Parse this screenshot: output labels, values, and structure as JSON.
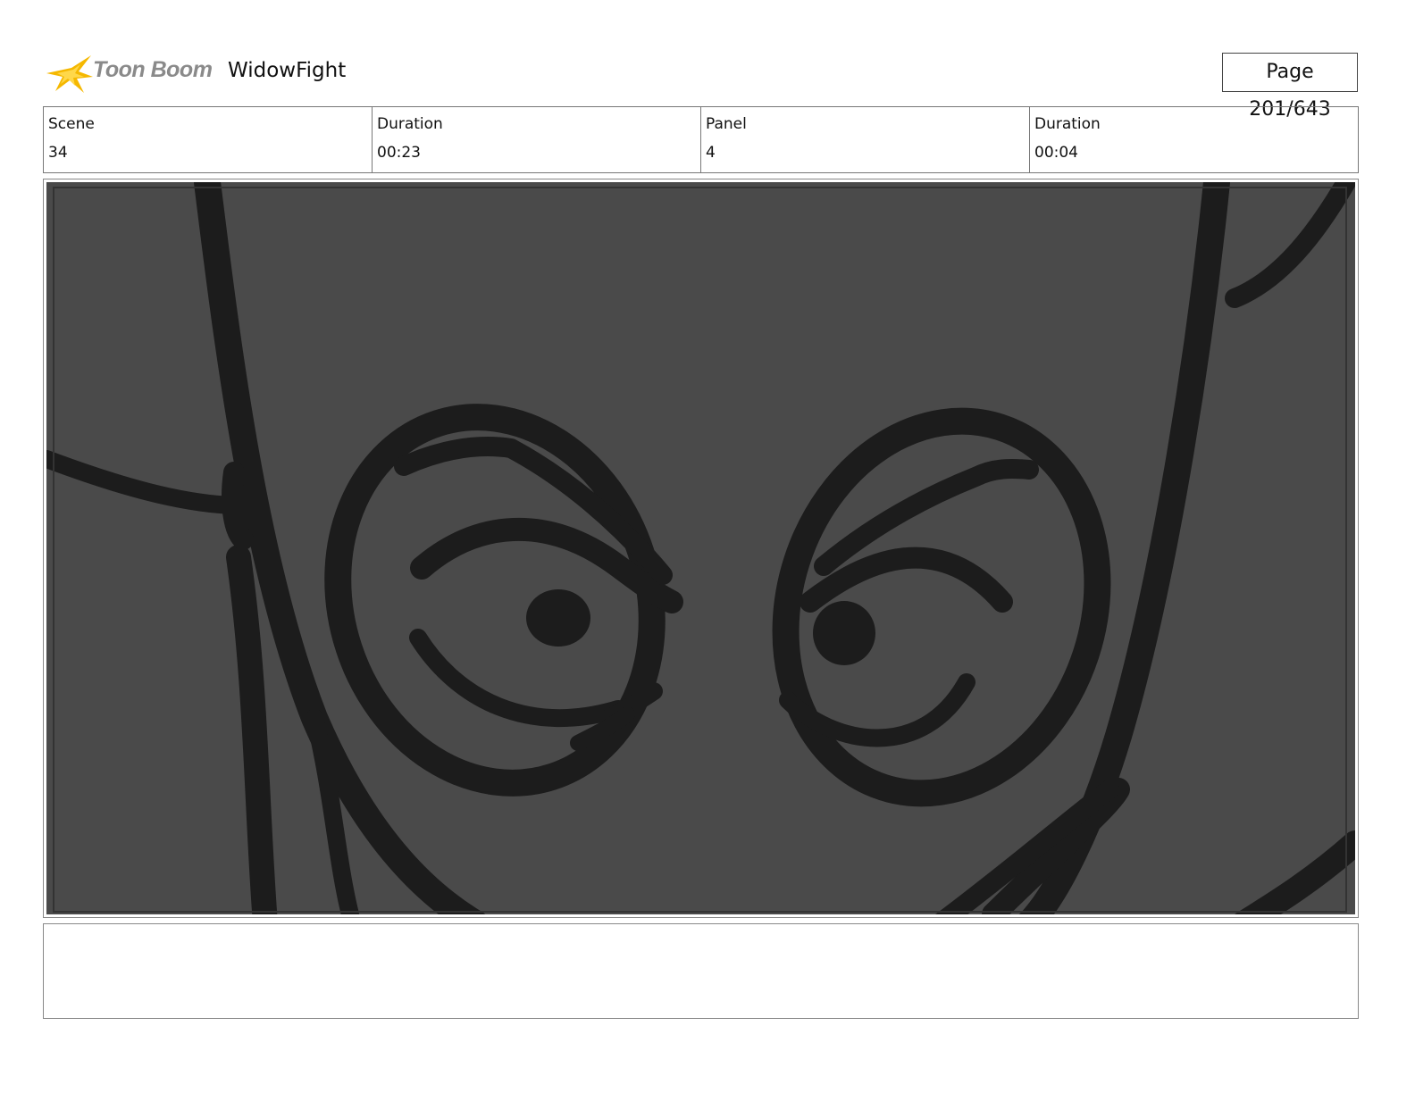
{
  "header": {
    "logo_text": "Toon Boom",
    "project_title": "WidowFight",
    "page_label": "Page 201/643"
  },
  "info": {
    "scene_label": "Scene",
    "scene_value": "34",
    "scene_duration_label": "Duration",
    "scene_duration_value": "00:23",
    "panel_label": "Panel",
    "panel_value": "4",
    "panel_duration_label": "Duration",
    "panel_duration_value": "00:04"
  },
  "panel": {
    "background_color": "#4a4a4a",
    "line_color": "#1c1c1c"
  },
  "notes": {
    "text": ""
  },
  "colors": {
    "logo_star": "#f5b800",
    "logo_text": "#8a8a8a"
  }
}
